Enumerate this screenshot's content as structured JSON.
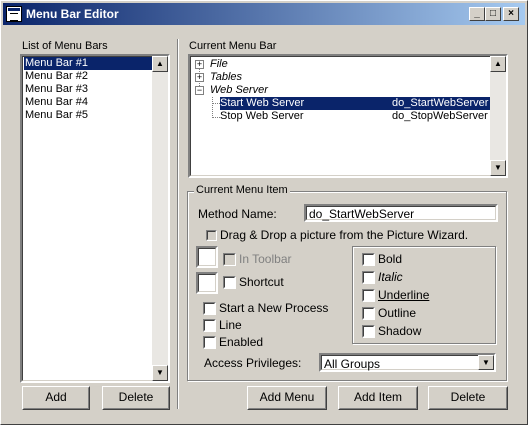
{
  "window": {
    "title": "Menu Bar Editor",
    "minimize": "_",
    "maximize": "□",
    "close": "×"
  },
  "left": {
    "label": "List of Menu Bars",
    "items": [
      "Menu Bar #1",
      "Menu Bar #2",
      "Menu Bar #3",
      "Menu Bar #4",
      "Menu Bar #5"
    ],
    "selected_index": 0,
    "add": "Add",
    "delete": "Delete"
  },
  "current_menu_bar": {
    "label": "Current Menu Bar",
    "tree": [
      {
        "text": "File",
        "expander": "+"
      },
      {
        "text": "Tables",
        "expander": "+"
      },
      {
        "text": "Web Server",
        "expander": "−"
      },
      {
        "text": "Start Web Server",
        "method": "do_StartWebServer",
        "selected": true
      },
      {
        "text": "Stop Web Server",
        "method": "do_StopWebServer"
      }
    ]
  },
  "current_menu_item": {
    "label": "Current Menu Item",
    "method_name_label": "Method Name:",
    "method_name_value": "do_StartWebServer",
    "drag_drop_label": "Drag & Drop a picture from the Picture Wizard.",
    "in_toolbar": "In Toolbar",
    "shortcut": "Shortcut",
    "start_new_process": "Start a New Process",
    "line": "Line",
    "enabled": "Enabled",
    "styles": {
      "bold": "Bold",
      "italic": "Italic",
      "underline": "Underline",
      "outline": "Outline",
      "shadow": "Shadow"
    },
    "access_label": "Access Privileges:",
    "access_value": "All Groups"
  },
  "bottom_buttons": {
    "add_menu": "Add Menu",
    "add_item": "Add Item",
    "delete": "Delete"
  }
}
